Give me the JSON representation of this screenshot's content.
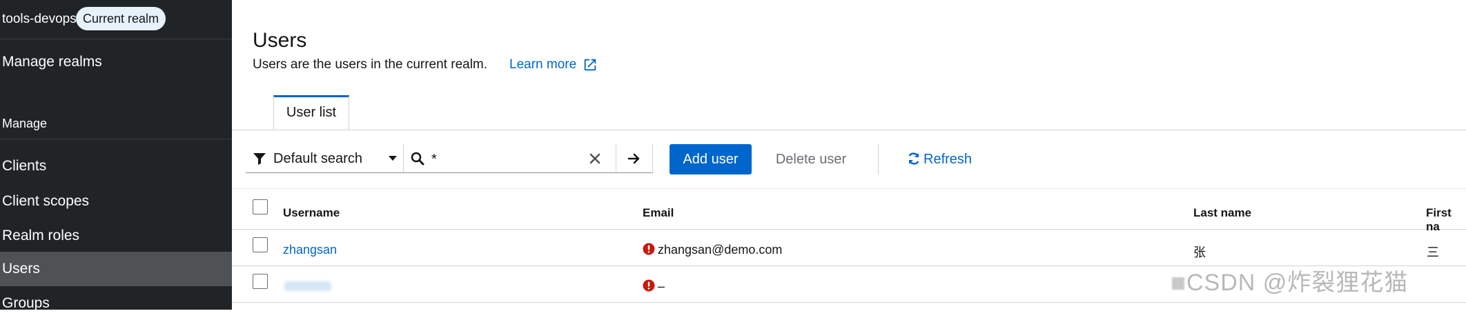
{
  "sidebar": {
    "realm_name": "tools-devops",
    "realm_badge": "Current realm",
    "manage_realms": "Manage realms",
    "section_title": "Manage",
    "items": [
      {
        "label": "Clients"
      },
      {
        "label": "Client scopes"
      },
      {
        "label": "Realm roles"
      },
      {
        "label": "Users",
        "active": true
      },
      {
        "label": "Groups"
      }
    ]
  },
  "header": {
    "title": "Users",
    "description": "Users are the users in the current realm.",
    "learn_more": "Learn more"
  },
  "tabs": [
    {
      "label": "User list",
      "active": true
    }
  ],
  "toolbar": {
    "filter_label": "Default search",
    "search_value": "*",
    "add_user": "Add user",
    "delete_user": "Delete user",
    "refresh": "Refresh"
  },
  "table": {
    "columns": [
      "Username",
      "Email",
      "Last name",
      "First na"
    ],
    "rows": [
      {
        "username": "zhangsan",
        "email": "zhangsan@demo.com",
        "last_name": "张",
        "first_name": "三",
        "email_warning": true
      },
      {
        "username": "",
        "email": "–",
        "last_name": "",
        "first_name": "",
        "email_warning": true
      }
    ]
  },
  "watermark": "CSDN @炸裂狸花猫",
  "colors": {
    "sidebar_bg": "#212427",
    "nav_active_bg": "#4f5255",
    "primary": "#0066cc",
    "error": "#c9190b"
  }
}
